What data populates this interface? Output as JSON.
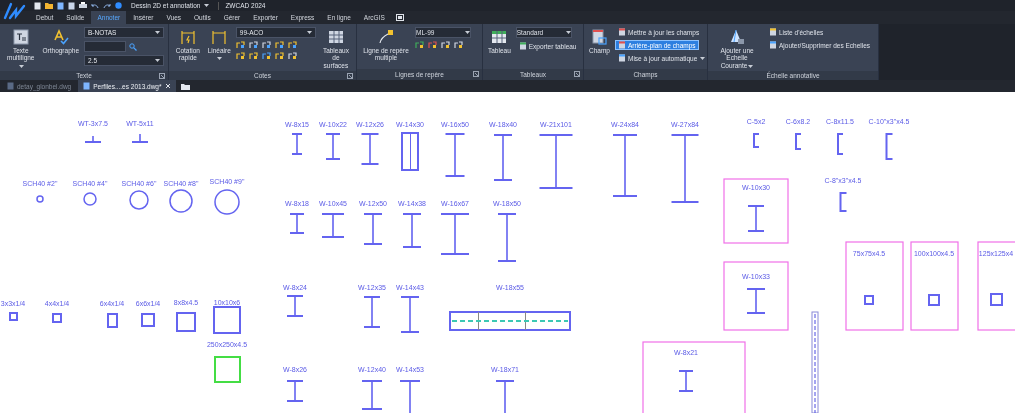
{
  "title_bar": {
    "workspace": "Dessin 2D et annotation",
    "app_title": "ZWCAD 2024"
  },
  "tabs": [
    {
      "label": "Debut",
      "selected": false
    },
    {
      "label": "Solide",
      "selected": false
    },
    {
      "label": "Annoter",
      "selected": true
    },
    {
      "label": "Insérer",
      "selected": false
    },
    {
      "label": "Vues",
      "selected": false
    },
    {
      "label": "Outils",
      "selected": false
    },
    {
      "label": "Gérer",
      "selected": false
    },
    {
      "label": "Exporter",
      "selected": false
    },
    {
      "label": "Express",
      "selected": false
    },
    {
      "label": "En ligne",
      "selected": false
    },
    {
      "label": "ArcGIS",
      "selected": false
    }
  ],
  "ribbon": {
    "panels": [
      {
        "title": "Texte",
        "launcher": true,
        "columns": [
          [
            {
              "kind": "large",
              "label": "Texte multiligne",
              "has_menu": true
            }
          ],
          [
            {
              "kind": "large",
              "label": "Orthographe",
              "has_menu": false
            }
          ],
          [
            {
              "kind": "dropdown",
              "value": "B-NOTAS"
            },
            {
              "kind": "search-field"
            },
            {
              "kind": "dropdown",
              "value": "2.5"
            }
          ]
        ]
      },
      {
        "title": "Cotes",
        "launcher": true,
        "columns": [
          [
            {
              "kind": "large",
              "label": "Cotation rapide",
              "has_menu": false
            }
          ],
          [
            {
              "kind": "large",
              "label": "Linéaire",
              "has_menu": true
            }
          ],
          [
            {
              "kind": "dropdown",
              "value": "99-ACO"
            },
            {
              "kind": "dimension-tools"
            }
          ],
          [
            {
              "kind": "large",
              "label": "Tableaux de surfaces",
              "has_menu": false
            }
          ]
        ]
      },
      {
        "title": "Lignes de repère",
        "launcher": true,
        "columns": [
          [
            {
              "kind": "large",
              "label": "Ligne de repère multiple",
              "has_menu": false
            }
          ],
          [
            {
              "kind": "dropdown",
              "value": "ML-99"
            },
            {
              "kind": "leader-tools"
            }
          ]
        ]
      },
      {
        "title": "Tableaux",
        "launcher": true,
        "columns": [
          [
            {
              "kind": "large",
              "label": "Tableau",
              "has_menu": false
            }
          ],
          [
            {
              "kind": "dropdown",
              "value": "Standard"
            },
            {
              "kind": "small",
              "label": "Exporter tableau",
              "on": false,
              "has_menu": false
            }
          ]
        ]
      },
      {
        "title": "Champs",
        "launcher": false,
        "columns": [
          [
            {
              "kind": "large",
              "label": "Champ",
              "has_menu": false
            }
          ],
          [
            {
              "kind": "small",
              "label": "Mettre à jour les champs",
              "on": false,
              "has_menu": false
            },
            {
              "kind": "small",
              "label": "Arrière-plan de champs",
              "on": true,
              "has_menu": false
            },
            {
              "kind": "small",
              "label": "Mise à jour automatique",
              "on": false,
              "has_menu": true
            }
          ]
        ]
      },
      {
        "title": "Échelle annotative",
        "launcher": false,
        "columns": [
          [
            {
              "kind": "large",
              "label": "Ajouter une Echelle Courante",
              "has_menu": true
            }
          ],
          [
            {
              "kind": "small",
              "label": "Liste d'échelles",
              "on": false,
              "has_menu": false
            },
            {
              "kind": "small",
              "label": "Ajouter/Supprimer des Echelles",
              "on": false,
              "has_menu": false
            }
          ]
        ]
      }
    ]
  },
  "document_tabs": [
    {
      "label": "detay_glonbel.dwg",
      "selected": false
    },
    {
      "label": "Perfiles....es 2013.dwg*",
      "selected": true
    }
  ],
  "drawing": {
    "items": [
      {
        "label": "WT-3x7.5",
        "kind": "tee",
        "color": "#6464f0"
      },
      {
        "label": "WT-5x11",
        "kind": "tee",
        "color": "#6464f0"
      },
      {
        "label": "W-8x15",
        "kind": "i-beam",
        "color": "#6464f0"
      },
      {
        "label": "W-10x22",
        "kind": "i-beam",
        "color": "#6464f0"
      },
      {
        "label": "W-12x26",
        "kind": "i-beam",
        "color": "#6464f0"
      },
      {
        "label": "W-14x30",
        "kind": "i-beam-side",
        "color": "#6464f0"
      },
      {
        "label": "W-16x50",
        "kind": "i-beam",
        "color": "#6464f0"
      },
      {
        "label": "W-18x40",
        "kind": "i-beam",
        "color": "#6464f0"
      },
      {
        "label": "W-21x101",
        "kind": "i-beam",
        "color": "#6464f0"
      },
      {
        "label": "W-24x84",
        "kind": "i-beam",
        "color": "#6464f0"
      },
      {
        "label": "W-27x84",
        "kind": "i-beam",
        "color": "#6464f0"
      },
      {
        "label": "C-5x2",
        "kind": "channel",
        "color": "#6464f0"
      },
      {
        "label": "C-6x8.2",
        "kind": "channel",
        "color": "#6464f0"
      },
      {
        "label": "C-8x11.5",
        "kind": "channel",
        "color": "#6464f0"
      },
      {
        "label": "C-10\"x3\"x4.5",
        "kind": "channel",
        "color": "#6464f0"
      },
      {
        "label": "SCH40 #2\"",
        "kind": "pipe",
        "color": "#6464f0"
      },
      {
        "label": "SCH40 #4\"",
        "kind": "pipe",
        "color": "#6464f0"
      },
      {
        "label": "SCH40 #6\"",
        "kind": "pipe",
        "color": "#6464f0"
      },
      {
        "label": "SCH40 #8\"",
        "kind": "pipe",
        "color": "#6464f0"
      },
      {
        "label": "SCH40 #9\"",
        "kind": "pipe",
        "color": "#6464f0"
      },
      {
        "label": "W-8x18",
        "kind": "i-beam",
        "color": "#6464f0"
      },
      {
        "label": "W-10x45",
        "kind": "i-beam",
        "color": "#6464f0"
      },
      {
        "label": "W-12x50",
        "kind": "i-beam",
        "color": "#6464f0"
      },
      {
        "label": "W-14x38",
        "kind": "i-beam",
        "color": "#6464f0"
      },
      {
        "label": "W-16x67",
        "kind": "i-beam",
        "color": "#6464f0"
      },
      {
        "label": "W-18x50",
        "kind": "i-beam",
        "color": "#6464f0"
      },
      {
        "label": "W-10x30",
        "kind": "framed-i-beam",
        "color": "#6464f0"
      },
      {
        "label": "C-8\"x3\"x4.5",
        "kind": "channel",
        "color": "#6464f0"
      },
      {
        "label": "75x75x4.5",
        "kind": "framed-tube",
        "color": "#6464f0"
      },
      {
        "label": "100x100x4.5",
        "kind": "framed-tube",
        "color": "#6464f0"
      },
      {
        "label": "125x125x4",
        "kind": "framed-tube",
        "color": "#6464f0"
      },
      {
        "label": "3x3x1/4",
        "kind": "tube",
        "color": "#6464f0"
      },
      {
        "label": "4x4x1/4",
        "kind": "tube",
        "color": "#6464f0"
      },
      {
        "label": "6x4x1/4",
        "kind": "tube",
        "color": "#6464f0"
      },
      {
        "label": "6x6x1/4",
        "kind": "tube",
        "color": "#6464f0"
      },
      {
        "label": "8x8x4.5",
        "kind": "tube",
        "color": "#6464f0"
      },
      {
        "label": "10x10x6",
        "kind": "tube",
        "color": "#6464f0"
      },
      {
        "label": "250x250x4.5",
        "kind": "tube",
        "color": "#44dd44"
      },
      {
        "label": "W-8x24",
        "kind": "i-beam",
        "color": "#6464f0"
      },
      {
        "label": "W-12x35",
        "kind": "i-beam",
        "color": "#6464f0"
      },
      {
        "label": "W-14x43",
        "kind": "i-beam",
        "color": "#6464f0"
      },
      {
        "label": "W-18x55",
        "kind": "plan-view",
        "color": "#6464f0"
      },
      {
        "label": "W-10x33",
        "kind": "framed-i-beam",
        "color": "#6464f0"
      },
      {
        "label": "W-8x21",
        "kind": "framed-i-beam",
        "color": "#6464f0"
      },
      {
        "label": "W-8x26",
        "kind": "i-beam",
        "color": "#6464f0"
      },
      {
        "label": "W-12x40",
        "kind": "i-beam",
        "color": "#6464f0"
      },
      {
        "label": "W-14x53",
        "kind": "i-beam",
        "color": "#6464f0"
      },
      {
        "label": "W-18x71",
        "kind": "i-beam",
        "color": "#6464f0"
      }
    ]
  }
}
